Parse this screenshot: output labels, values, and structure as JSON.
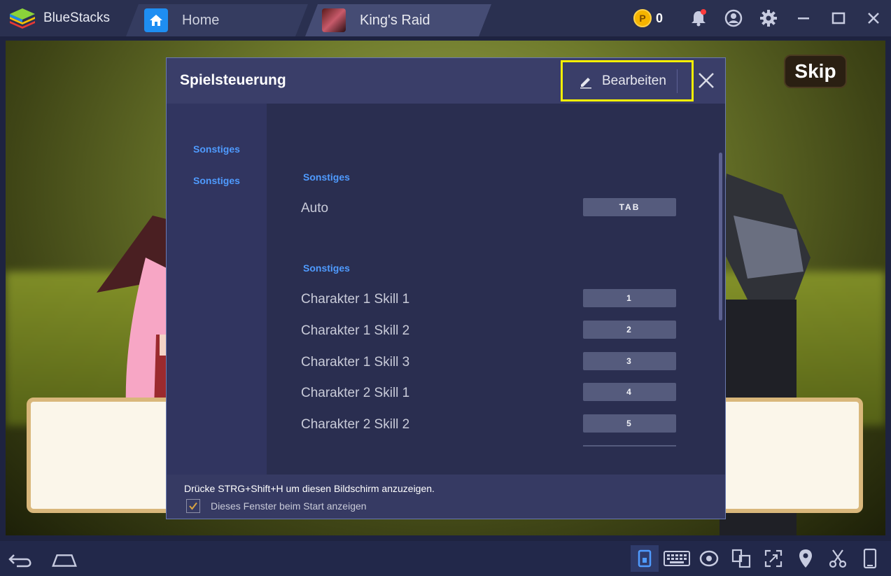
{
  "titlebar": {
    "app_name": "BlueStacks",
    "tabs": [
      {
        "label": "Home",
        "icon": "home-icon"
      },
      {
        "label": "King's Raid",
        "icon": "game-icon"
      }
    ],
    "coin_symbol": "P",
    "coin_count": "0",
    "icons": [
      "bell-icon",
      "profile-icon",
      "gear-icon",
      "minimize-icon",
      "maximize-icon",
      "close-icon"
    ],
    "notification_color": "#ff3b3b"
  },
  "game": {
    "skip_label": "Skip"
  },
  "dialog": {
    "title": "Spielsteuerung",
    "edit_label": "Bearbeiten",
    "sidebar": [
      "Sonstiges",
      "Sonstiges"
    ],
    "sections": [
      {
        "title": "Sonstiges",
        "rows": [
          {
            "label": "Auto",
            "key": "TAB"
          }
        ]
      },
      {
        "title": "Sonstiges",
        "rows": [
          {
            "label": "Charakter 1 Skill 1",
            "key": "1"
          },
          {
            "label": "Charakter 1 Skill 2",
            "key": "2"
          },
          {
            "label": "Charakter 1 Skill 3",
            "key": "3"
          },
          {
            "label": "Charakter 2 Skill 1",
            "key": "4"
          },
          {
            "label": "Charakter 2 Skill 2",
            "key": "5"
          }
        ]
      }
    ],
    "footer_hint": "Drücke STRG+Shift+H um diesen Bildschirm anzuzeigen.",
    "show_on_start_label": "Dieses Fenster beim Start anzeigen",
    "show_on_start_checked": true,
    "highlight_color": "#f7ef00",
    "accent_color": "#4f9bff"
  },
  "bottombar": {
    "left_icons": [
      "back-icon",
      "home-icon"
    ],
    "right_icons": [
      "game-controls-icon",
      "keyboard-icon",
      "eye-icon",
      "multi-instance-icon",
      "fullscreen-icon",
      "location-icon",
      "scissors-icon",
      "phone-rotate-icon"
    ]
  }
}
